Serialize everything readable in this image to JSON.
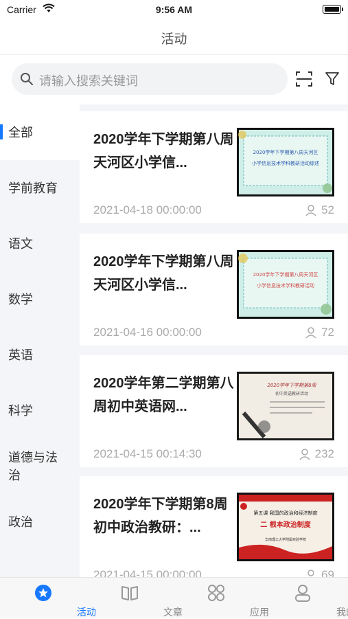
{
  "status": {
    "carrier": "Carrier",
    "time": "9:56 AM"
  },
  "nav": {
    "title": "活动"
  },
  "search": {
    "placeholder": "请输入搜索关键词"
  },
  "categories": [
    {
      "label": "全部",
      "active": true
    },
    {
      "label": "学前教育"
    },
    {
      "label": "语文"
    },
    {
      "label": "数学"
    },
    {
      "label": "英语"
    },
    {
      "label": "科学"
    },
    {
      "label": "道德与法治"
    },
    {
      "label": "政治"
    }
  ],
  "activities": [
    {
      "title": "2020学年下学期第八周天河区小学信...",
      "date": "2021-04-18 00:00:00",
      "views": "52",
      "thumb": {
        "line1": "2020学年下学期第八周天河区",
        "line2": "小学信息技术学科教研活动综述"
      }
    },
    {
      "title": "2020学年下学期第八周天河区小学信...",
      "date": "2021-04-16 00:00:00",
      "views": "72",
      "thumb": {
        "line1": "2020学年下学期第八周天河区",
        "line2": "小学信息技术学科教研活动"
      }
    },
    {
      "title": "2020学年第二学期第八周初中英语网...",
      "date": "2021-04-15 00:14:30",
      "views": "232",
      "thumb": {
        "line1": "2020学年下学期第8周",
        "line2": "初中英语教研活动"
      }
    },
    {
      "title": "2020学年下学期第8周初中政治教研：...",
      "date": "2021-04-15 00:00:00",
      "views": "69",
      "thumb": {
        "line1": "第五课 我国的政治和经济制度",
        "line2": "二 根本政治制度",
        "line3": "华南理工大学附属实验学校"
      }
    }
  ],
  "tabs": [
    {
      "label": "活动",
      "icon": "activity-star-icon",
      "active": true
    },
    {
      "label": "文章",
      "icon": "book-icon"
    },
    {
      "label": "应用",
      "icon": "apps-grid-icon"
    },
    {
      "label": "我的",
      "icon": "profile-icon"
    }
  ],
  "colors": {
    "accent": "#1677ff",
    "sidebar_bg": "#f3f5f8"
  }
}
